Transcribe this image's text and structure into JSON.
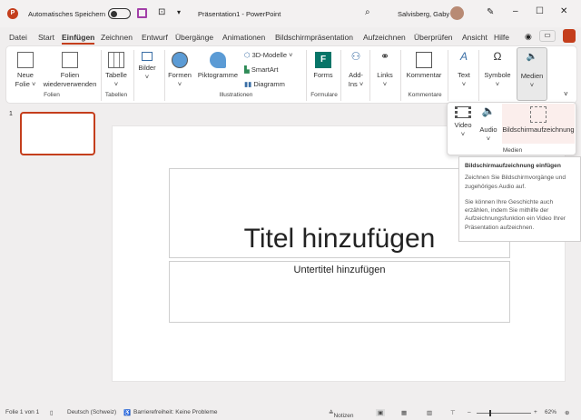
{
  "titlebar": {
    "autosave_label": "Automatisches Speichern",
    "doc_title": "Präsentation1  -  PowerPoint",
    "user": "Salvisberg, Gaby"
  },
  "tabs": [
    "Datei",
    "Start",
    "Einfügen",
    "Zeichnen",
    "Entwurf",
    "Übergänge",
    "Animationen",
    "Bildschirmpräsentation",
    "Aufzeichnen",
    "Überprüfen",
    "Ansicht",
    "Hilfe"
  ],
  "ribbon": {
    "neue_folie": "Neue",
    "neue_folie2": "Folie ˅",
    "folien_wv": "Folien",
    "folien_wv2": "wiederverwenden",
    "grp_folien": "Folien",
    "tabelle": "Tabelle",
    "grp_tabellen": "Tabellen",
    "bilder": "Bilder",
    "formen": "Formen",
    "piktogramme": "Piktogramme",
    "modelle": "3D-Modelle",
    "smartart": "SmartArt",
    "diagramm": "Diagramm",
    "grp_illustrationen": "Illustrationen",
    "forms": "Forms",
    "grp_formulare": "Formulare",
    "addins": "Add-",
    "addins2": "Ins ˅",
    "links": "Links",
    "kommentar": "Kommentar",
    "grp_kommentare": "Kommentare",
    "text": "Text",
    "symbole": "Symbole",
    "medien": "Medien"
  },
  "medien_menu": {
    "video": "Video",
    "audio": "Audio",
    "screen": "Bildschirmaufzeichnung",
    "group": "Medien"
  },
  "tooltip": {
    "title": "Bildschirmaufzeichnung einfügen",
    "p1": "Zeichnen Sie Bildschirmvorgänge und zugehöriges Audio auf.",
    "p2": "Sie können Ihre Geschichte auch erzählen, indem Sie mithilfe der Aufzeichnungsfunktion ein Video Ihrer Präsentation aufzeichnen."
  },
  "slide": {
    "number": "1",
    "title": "Titel hinzufügen",
    "subtitle": "Untertitel hinzufügen"
  },
  "status": {
    "slide": "Folie 1 von 1",
    "language": "Deutsch (Schweiz)",
    "accessibility": "Barrierefreiheit: Keine Probleme",
    "notes": "Notizen",
    "zoom": "62%"
  },
  "colors": {
    "accent": "#c43e1c",
    "media_active": "#e9e9e9"
  }
}
